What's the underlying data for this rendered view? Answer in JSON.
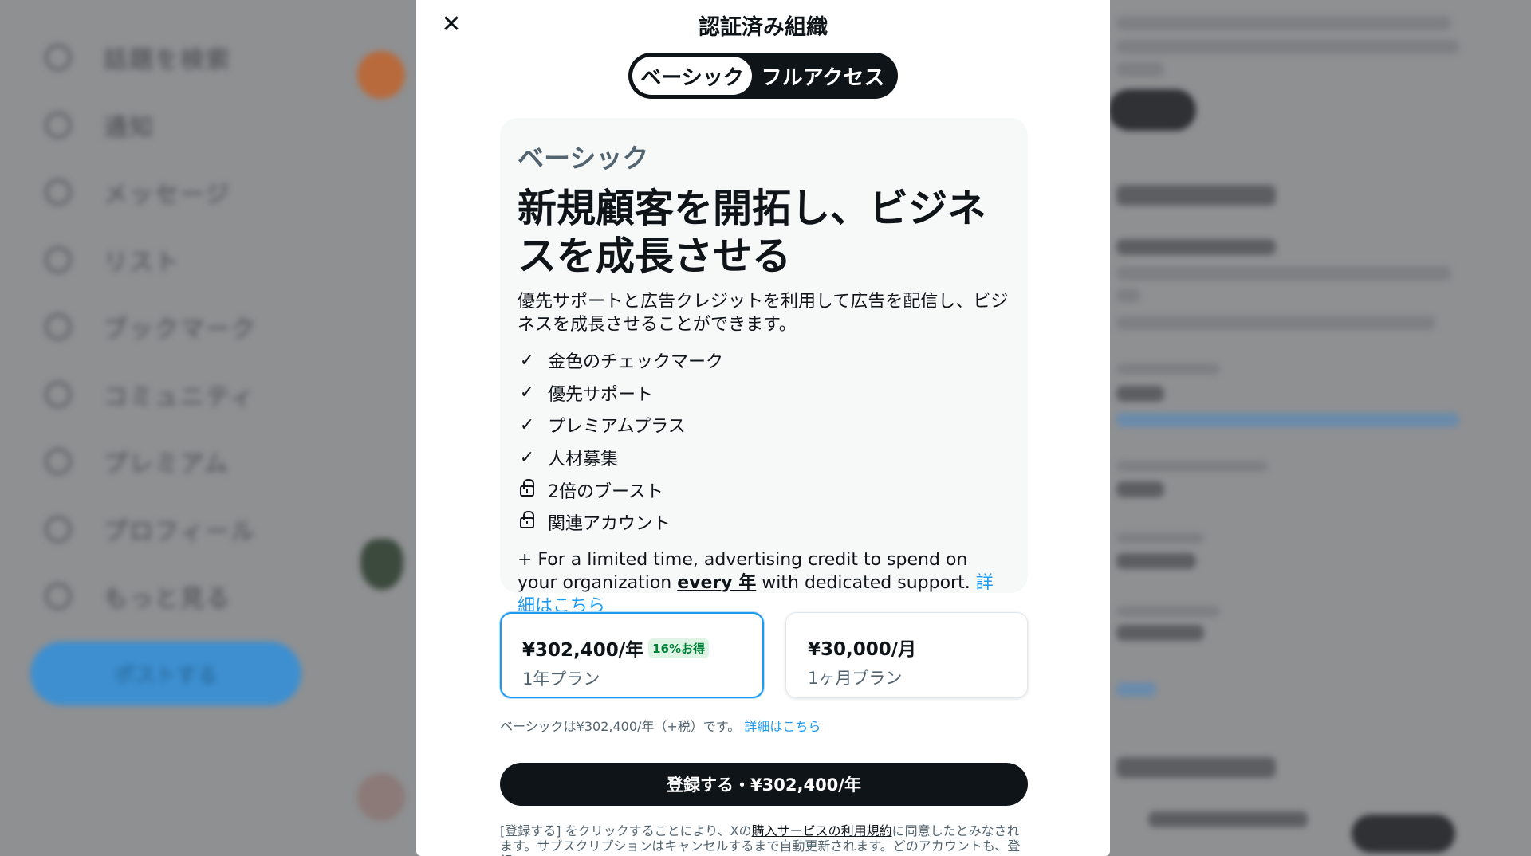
{
  "background": {
    "nav_items": [
      {
        "icon": "search-icon",
        "label": "話題を検索"
      },
      {
        "icon": "bell-icon",
        "label": "通知"
      },
      {
        "icon": "mail-icon",
        "label": "メッセージ"
      },
      {
        "icon": "list-icon",
        "label": "リスト"
      },
      {
        "icon": "bookmark-icon",
        "label": "ブックマーク"
      },
      {
        "icon": "people-icon",
        "label": "コミュニティ"
      },
      {
        "icon": "x-logo-icon",
        "label": "プレミアム"
      },
      {
        "icon": "profile-icon",
        "label": "プロフィール"
      },
      {
        "icon": "more-icon",
        "label": "もっと見る"
      }
    ],
    "post_button": "ポストする"
  },
  "modal": {
    "close_icon": "close-icon",
    "title": "認証済み組織",
    "toggle": {
      "basic": "ベーシック",
      "full": "フルアクセス"
    },
    "plan": {
      "name": "ベーシック",
      "headline": "新規顧客を開拓し、ビジネスを成長させる",
      "description": "優先サポートと広告クレジットを利用して広告を配信し、ビジネスを成長させることができます。",
      "features": [
        {
          "icon": "check-icon",
          "label": "金色のチェックマーク"
        },
        {
          "icon": "check-icon",
          "label": "優先サポート"
        },
        {
          "icon": "check-icon",
          "label": "プレミアムプラス"
        },
        {
          "icon": "check-icon",
          "label": "人材募集"
        },
        {
          "icon": "lock-icon",
          "label": "2倍のブースト"
        },
        {
          "icon": "lock-icon",
          "label": "関連アカウント"
        }
      ],
      "note_prefix": "+ For a limited time, advertising credit to spend on your organization ",
      "note_emphasis": "every 年",
      "note_suffix": " with dedicated support. ",
      "note_link": "詳細はこちら"
    },
    "pricing": {
      "annual": {
        "amount": "¥302,400/年",
        "badge": "16%お得",
        "term": "1年プラン",
        "selected": true
      },
      "monthly": {
        "amount": "¥30,000/月",
        "term": "1ヶ月プラン",
        "selected": false
      }
    },
    "tax_note": "ベーシックは¥302,400/年（+税）です。",
    "tax_link": "詳細はこちら",
    "subscribe_button": "登録する・¥302,400/年",
    "legal_prefix": "[登録する] をクリックすることにより、Xの",
    "legal_terms": "購入サービスの利用規約",
    "legal_suffix": "に同意したとみなされます。サブスクリプションはキャンセルするまで自動更新されます。どのアカウントも、登録"
  },
  "colors": {
    "accent": "#1d9bf0",
    "text": "#0f1419",
    "muted": "#536471",
    "badge_bg": "#dff4e4",
    "badge_text": "#00813a"
  }
}
